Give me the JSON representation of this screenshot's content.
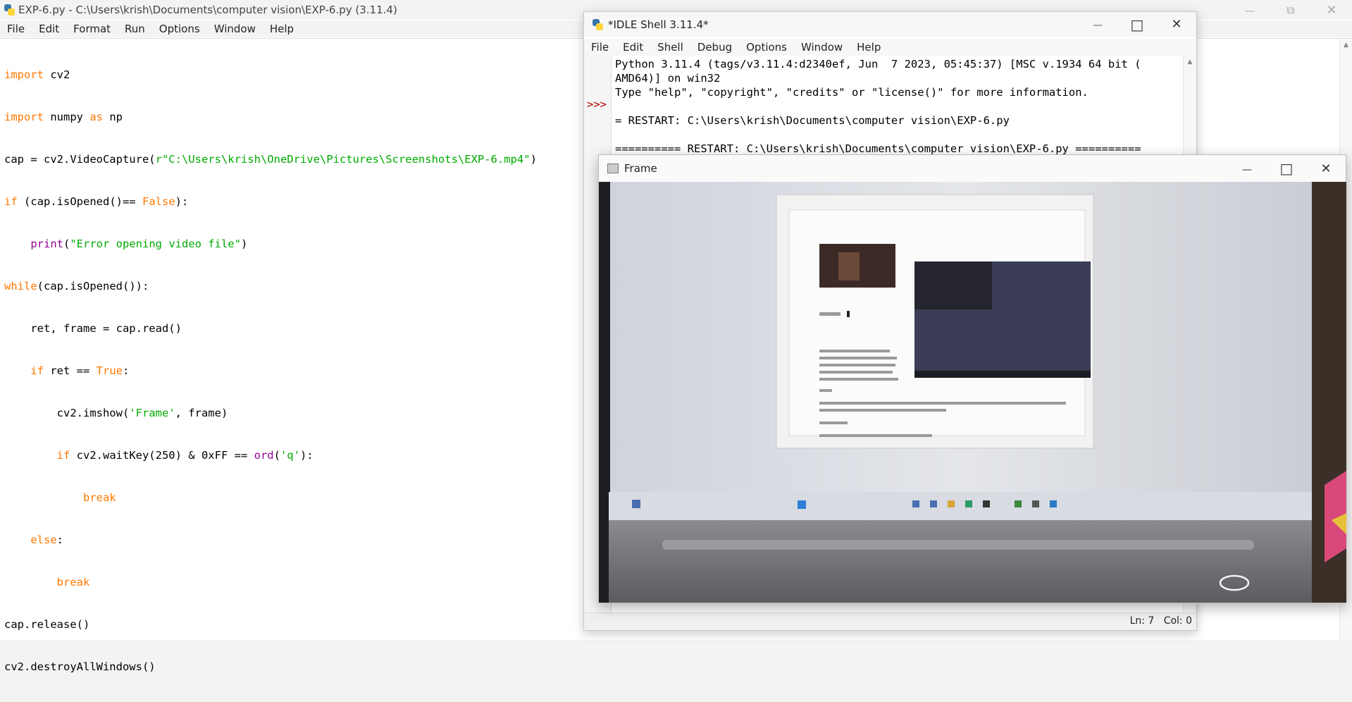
{
  "editor": {
    "title": "EXP-6.py - C:\\Users\\krish\\Documents\\computer vision\\EXP-6.py (3.11.4)",
    "menu": [
      "File",
      "Edit",
      "Format",
      "Run",
      "Options",
      "Window",
      "Help"
    ],
    "code": [
      "import cv2",
      "import numpy as np",
      "cap = cv2.VideoCapture(r\"C:\\Users\\krish\\OneDrive\\Pictures\\Screenshots\\EXP-6.mp4\")",
      "if (cap.isOpened()== False):",
      "    print(\"Error opening video file\")",
      "while(cap.isOpened()):",
      "    ret, frame = cap.read()",
      "    if ret == True:",
      "        cv2.imshow('Frame', frame)",
      "        if cv2.waitKey(250) & 0xFF == ord('q'):",
      "            break",
      "    else:",
      "        break",
      "cap.release()",
      "cv2.destroyAllWindows()"
    ]
  },
  "shell": {
    "title": "*IDLE Shell 3.11.4*",
    "menu": [
      "File",
      "Edit",
      "Shell",
      "Debug",
      "Options",
      "Window",
      "Help"
    ],
    "prompt": ">>>",
    "lines": [
      "Python 3.11.4 (tags/v3.11.4:d2340ef, Jun  7 2023, 05:45:37) [MSC v.1934 64 bit (",
      "AMD64)] on win32",
      "Type \"help\", \"copyright\", \"credits\" or \"license()\" for more information.",
      "",
      "= RESTART: C:\\Users\\krish\\Documents\\computer vision\\EXP-6.py",
      "",
      "========== RESTART: C:\\Users\\krish\\Documents\\computer vision\\EXP-6.py =========="
    ],
    "status": "Ln: 7   Col: 0"
  },
  "frame": {
    "title": "Frame"
  },
  "colors": {
    "keyword": "#ff7700",
    "builtin": "#900090",
    "string": "#00aa00"
  }
}
